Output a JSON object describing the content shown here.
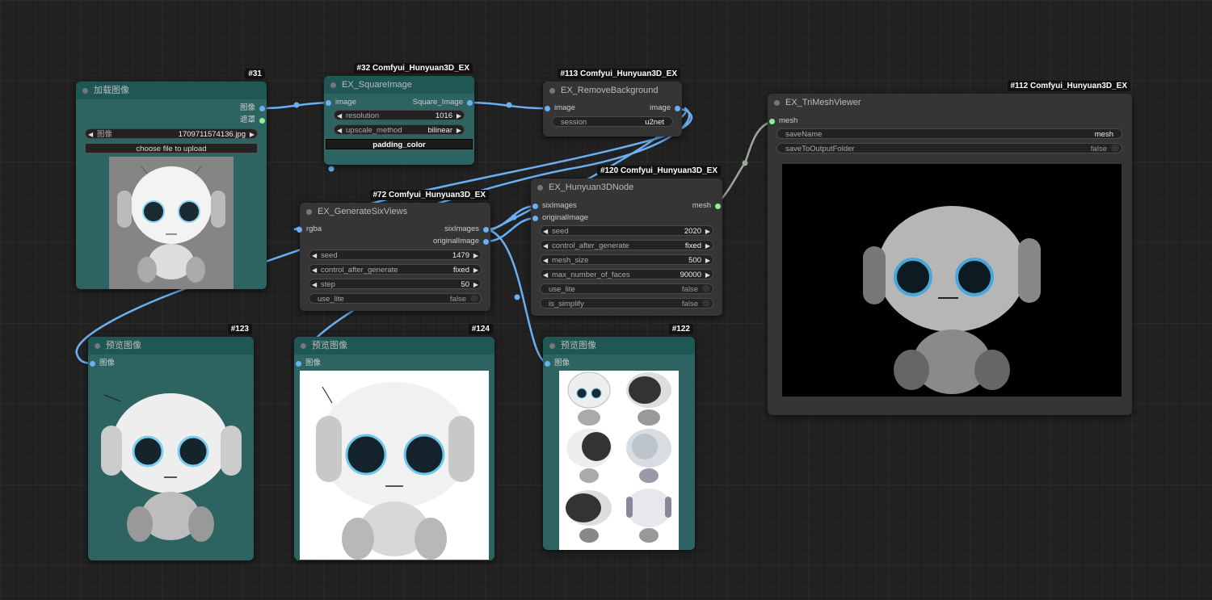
{
  "nodes": {
    "n31": {
      "id": "#31",
      "title": "加载图像",
      "outputs": [
        "图像",
        "遮罩"
      ],
      "image_widget": {
        "label": "图像",
        "value": "1709711574136.jpg"
      },
      "upload_button": "choose file to upload"
    },
    "n32": {
      "id": "#32 Comfyui_Hunyuan3D_EX",
      "title": "EX_SquareImage",
      "input": "image",
      "output": "Square_Image",
      "resolution": {
        "label": "resolution",
        "value": "1016"
      },
      "upscale": {
        "label": "upscale_method",
        "value": "bilinear"
      },
      "padding": "padding_color"
    },
    "n113": {
      "id": "#113 Comfyui_Hunyuan3D_EX",
      "title": "EX_RemoveBackground",
      "input": "image",
      "output": "image",
      "session": {
        "label": "session",
        "value": "u2net"
      }
    },
    "n112": {
      "id": "#112 Comfyui_Hunyuan3D_EX",
      "title": "EX_TriMeshViewer",
      "input": "mesh",
      "saveName": {
        "label": "saveName",
        "value": "mesh"
      },
      "saveToOutput": {
        "label": "saveToOutputFolder",
        "value": "false"
      }
    },
    "n120": {
      "id": "#120 Comfyui_Hunyuan3D_EX",
      "title": "EX_Hunyuan3DNode",
      "inputs": [
        "sixImages",
        "originalImage"
      ],
      "output": "mesh",
      "seed": {
        "label": "seed",
        "value": "2020"
      },
      "control": {
        "label": "control_after_generate",
        "value": "fixed"
      },
      "mesh_size": {
        "label": "mesh_size",
        "value": "500"
      },
      "faces": {
        "label": "max_number_of_faces",
        "value": "90000"
      },
      "use_lite": {
        "label": "use_lite",
        "value": "false"
      },
      "is_simplify": {
        "label": "is_simplify",
        "value": "false"
      }
    },
    "n72": {
      "id": "#72 Comfyui_Hunyuan3D_EX",
      "title": "EX_GenerateSixViews",
      "input": "rgba",
      "outputs": [
        "sixImages",
        "originalImage"
      ],
      "seed": {
        "label": "seed",
        "value": "1479"
      },
      "control": {
        "label": "control_after_generate",
        "value": "fixed"
      },
      "step": {
        "label": "step",
        "value": "50"
      },
      "use_lite": {
        "label": "use_lite",
        "value": "false"
      }
    },
    "n123": {
      "id": "#123",
      "title": "预览图像",
      "input": "图像"
    },
    "n124": {
      "id": "#124",
      "title": "预览图像",
      "input": "图像"
    },
    "n122": {
      "id": "#122",
      "title": "预览图像",
      "input": "图像"
    }
  },
  "colors": {
    "canvas": "#222222",
    "node": "#353535",
    "node_teal": "#2d6360",
    "title_teal": "#1f5754",
    "wire_image": "#6ab0f3",
    "wire_mesh": "#9aa89a",
    "mask_socket": "#8cf28c"
  }
}
